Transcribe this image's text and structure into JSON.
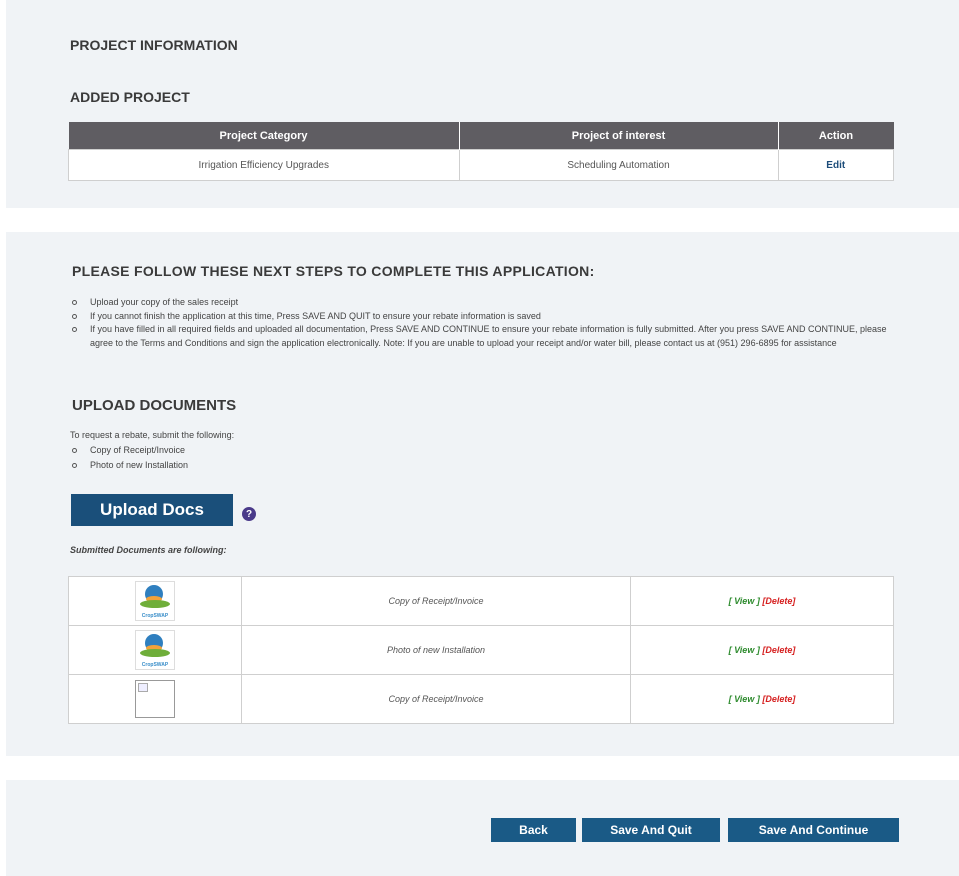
{
  "project_info": {
    "title": "PROJECT INFORMATION",
    "added_title": "ADDED PROJECT",
    "columns": [
      "Project Category",
      "Project of interest",
      "Action"
    ],
    "rows": [
      {
        "category": "Irrigation Efficiency Upgrades",
        "interest": "Scheduling Automation",
        "action": "Edit"
      }
    ]
  },
  "steps": {
    "title": "PLEASE FOLLOW THESE NEXT STEPS TO COMPLETE THIS APPLICATION:",
    "items": [
      "Upload your copy of the sales receipt",
      "If you cannot finish the application at this time, Press SAVE AND QUIT to ensure your rebate information is saved",
      "If you have filled in all required fields and uploaded all documentation, Press SAVE AND CONTINUE to ensure your rebate information is fully submitted. After you press SAVE AND CONTINUE, please agree to the Terms and Conditions and sign the application electronically. Note: If you are unable to upload your receipt and/or water bill, please contact us at (951) 296-6895 for assistance"
    ]
  },
  "upload": {
    "title": "UPLOAD DOCUMENTS",
    "intro": "To request a rebate, submit the following:",
    "required": [
      "Copy of Receipt/Invoice",
      "Photo of new Installation"
    ],
    "button_label": "Upload Docs",
    "help_icon": "question-circle-icon",
    "submitted_label": "Submitted Documents are following:",
    "thumb_brand": "CropSWAP",
    "documents": [
      {
        "thumb": "cropswap-logo",
        "name": "Copy of Receipt/Invoice",
        "view": "[ View ]",
        "delete": "[Delete]"
      },
      {
        "thumb": "cropswap-logo",
        "name": "Photo of new Installation",
        "view": "[ View ]",
        "delete": "[Delete]"
      },
      {
        "thumb": "broken-image",
        "name": "Copy of Receipt/Invoice",
        "view": "[ View ]",
        "delete": "[Delete]"
      }
    ]
  },
  "footer": {
    "back": "Back",
    "save_quit": "Save And Quit",
    "save_continue": "Save And Continue"
  },
  "colors": {
    "button_blue": "#1a5a86",
    "table_header": "#5f5d62",
    "panel_bg": "#f0f3f6",
    "view_green": "#2e8b2e",
    "delete_red": "#d62020"
  }
}
